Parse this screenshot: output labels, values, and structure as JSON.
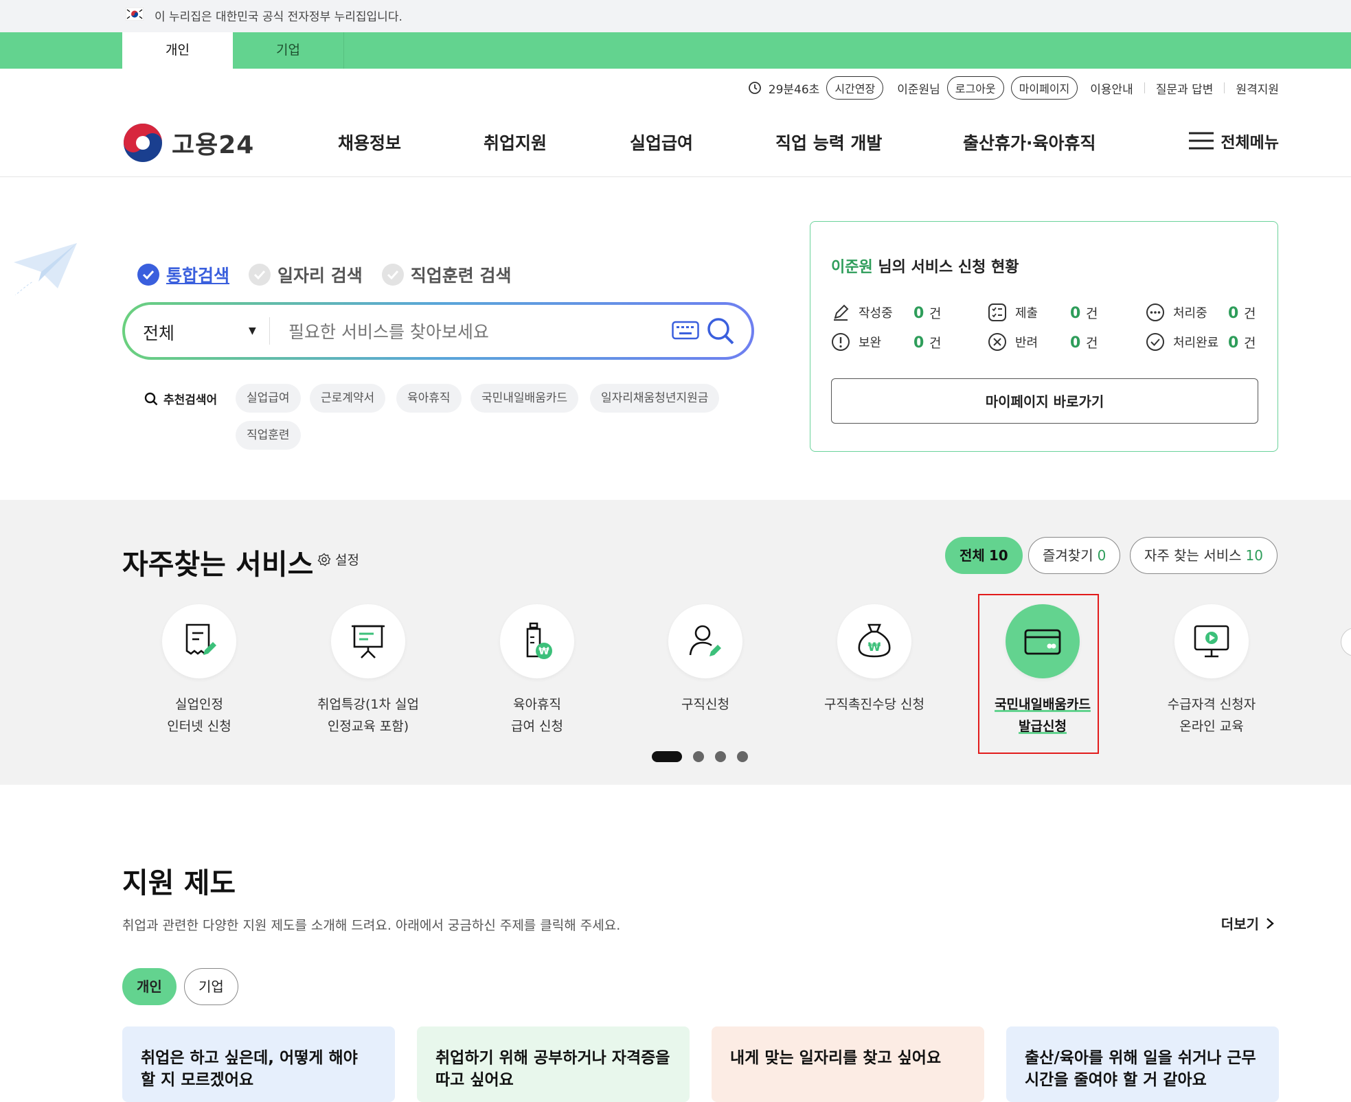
{
  "gov_banner": {
    "text": "이 누리집은 대한민국 공식 전자정부 누리집입니다."
  },
  "user_type_tabs": [
    "개인",
    "기업"
  ],
  "util": {
    "timer": "29분46초",
    "extend": "시간연장",
    "user": "이준원님",
    "logout": "로그아웃",
    "mypage": "마이페이지",
    "guide": "이용안내",
    "qna": "질문과 답변",
    "remote": "원격지원"
  },
  "header": {
    "logo_text": "고용24",
    "nav": [
      "채용정보",
      "취업지원",
      "실업급여",
      "직업 능력 개발",
      "출산휴가·육아휴직"
    ],
    "all_menu": "전체메뉴"
  },
  "search": {
    "tabs": [
      "통합검색",
      "일자리 검색",
      "직업훈련 검색"
    ],
    "select_value": "전체",
    "placeholder": "필요한 서비스를 찾아보세요",
    "reco_label": "추천검색어",
    "reco_chips": [
      "실업급여",
      "근로계약서",
      "육아휴직",
      "국민내일배움카드",
      "일자리채움청년지원금",
      "직업훈련"
    ]
  },
  "status": {
    "name": "이준원",
    "title_rest": " 님의 서비스 신청 현황",
    "items": [
      {
        "label": "작성중",
        "count": "0",
        "unit": "건"
      },
      {
        "label": "제출",
        "count": "0",
        "unit": "건"
      },
      {
        "label": "처리중",
        "count": "0",
        "unit": "건"
      },
      {
        "label": "보완",
        "count": "0",
        "unit": "건"
      },
      {
        "label": "반려",
        "count": "0",
        "unit": "건"
      },
      {
        "label": "처리완료",
        "count": "0",
        "unit": "건"
      }
    ],
    "mypage_button": "마이페이지 바로가기"
  },
  "frequent": {
    "title": "자주찾는 서비스",
    "setting": "설정",
    "filters": [
      {
        "label": "전체",
        "count": "10"
      },
      {
        "label": "즐겨찾기",
        "count": "0"
      },
      {
        "label": "자주 찾는 서비스",
        "count": "10"
      }
    ],
    "services": [
      {
        "label": "실업인정\n인터넷 신청",
        "icon": "document-edit-icon"
      },
      {
        "label": "취업특강(1차 실업\n인정교육 포함)",
        "icon": "presentation-board-icon"
      },
      {
        "label": "육아휴직\n급여 신청",
        "icon": "baby-bottle-won-icon"
      },
      {
        "label": "구직신청",
        "icon": "person-edit-icon"
      },
      {
        "label": "구직촉진수당 신청",
        "icon": "money-bag-won-icon"
      },
      {
        "label": "국민내일배움카드\n발급신청",
        "icon": "card-icon"
      },
      {
        "label": "수급자격 신청자\n온라인 교육",
        "icon": "monitor-play-icon"
      }
    ]
  },
  "support": {
    "title": "지원 제도",
    "desc": "취업과 관련한 다양한 지원 제도를 소개해 드려요. 아래에서 궁금하신 주제를 클릭해 주세요.",
    "more": "더보기",
    "tabs": [
      "개인",
      "기업"
    ],
    "cards": [
      {
        "text": "취업은 하고 싶은데, 어떻게 해야 할 지 모르겠어요",
        "bg": "#e6effc"
      },
      {
        "text": "취업하기 위해 공부하거나 자격증을 따고 싶어요",
        "bg": "#e8f7ec"
      },
      {
        "text": "내게 맞는 일자리를 찾고 싶어요",
        "bg": "#fcece4"
      },
      {
        "text": "출산/육아를 위해 일을 쉬거나 근무 시간을 줄여야 할 거 같아요",
        "bg": "#e6effc"
      }
    ]
  },
  "colors": {
    "brand_green": "#63d38f",
    "accent_blue": "#3a5fdd",
    "highlight_red": "#e21b1b"
  }
}
